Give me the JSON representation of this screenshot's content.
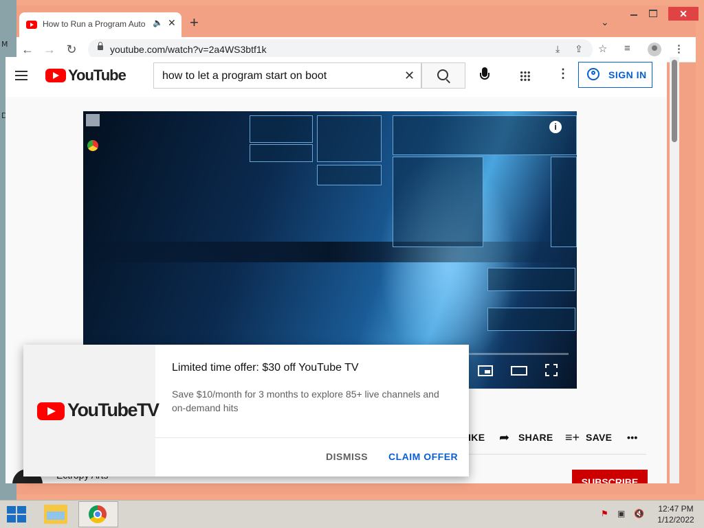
{
  "desktop": {
    "letters": [
      "M",
      "D"
    ]
  },
  "browser": {
    "tab": {
      "title": "How to Run a Program Automatically",
      "audio_icon": "speaker-icon",
      "close_icon": "close-icon"
    },
    "new_tab_icon": "plus-icon",
    "window_controls": [
      "minimize",
      "maximize",
      "close"
    ],
    "address": {
      "url": "youtube.com/watch?v=2a4WS3btf1k"
    }
  },
  "youtube": {
    "logo_text": "YouTube",
    "search": {
      "value": "how to let a program start on boot"
    },
    "signin_label": "SIGN IN",
    "video": {
      "progress": 0
    },
    "actions": {
      "dislike": "DISLIKE",
      "share": "SHARE",
      "save": "SAVE"
    },
    "channel": {
      "name": "Ectropy Arts",
      "subscribe": "SUBSCRIBE"
    }
  },
  "promo": {
    "logo_text": "YouTubeTV",
    "title": "Limited time offer: $30 off YouTube TV",
    "description": "Save $10/month for 3 months to explore 85+ live channels and on-demand hits",
    "dismiss": "DISMISS",
    "claim": "CLAIM OFFER",
    "accent": "#065fd4"
  },
  "taskbar": {
    "time": "12:47 PM",
    "date": "1/12/2022"
  }
}
